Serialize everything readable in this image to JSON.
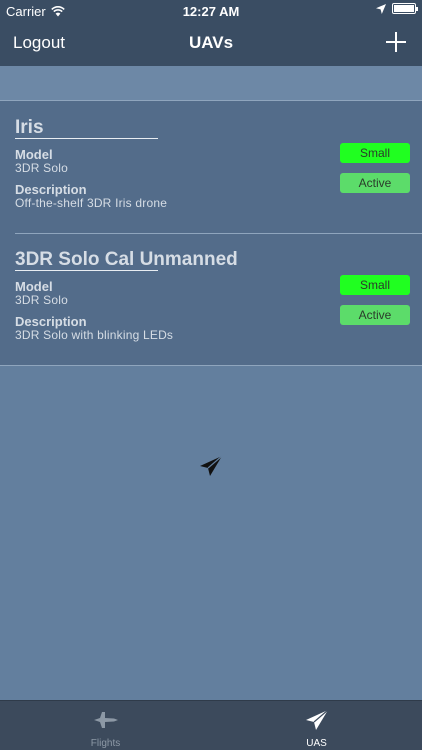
{
  "status_bar": {
    "carrier": "Carrier",
    "time": "12:27 AM",
    "wifi_icon": "wifi-icon",
    "location_icon": "location-arrow-icon",
    "battery_icon": "battery-icon",
    "battery_level": 1.0
  },
  "navbar": {
    "left_button": "Logout",
    "title": "UAVs",
    "right_icon": "plus-icon"
  },
  "uavs": [
    {
      "name": "Iris",
      "model_label": "Model",
      "model": "3DR Solo",
      "description_label": "Description",
      "description": "Off-the-shelf 3DR Iris drone",
      "size": "Small",
      "status": "Active"
    },
    {
      "name": "3DR Solo Cal Unmanned",
      "model_label": "Model",
      "model": "3DR Solo",
      "description_label": "Description",
      "description": "3DR Solo with blinking LEDs",
      "size": "Small",
      "status": "Active"
    }
  ],
  "center_icon": "paper-plane-icon",
  "tabbar": {
    "tabs": [
      {
        "label": "Flights",
        "icon": "jet-icon",
        "selected": false
      },
      {
        "label": "UAS",
        "icon": "paper-plane-icon",
        "selected": true
      }
    ]
  },
  "colors": {
    "bar_background": "#3a4d63",
    "page_background": "#637f9e",
    "list_background": "#536c8a",
    "size_badge": "#20ff20",
    "status_badge": "#5cdc6a"
  }
}
